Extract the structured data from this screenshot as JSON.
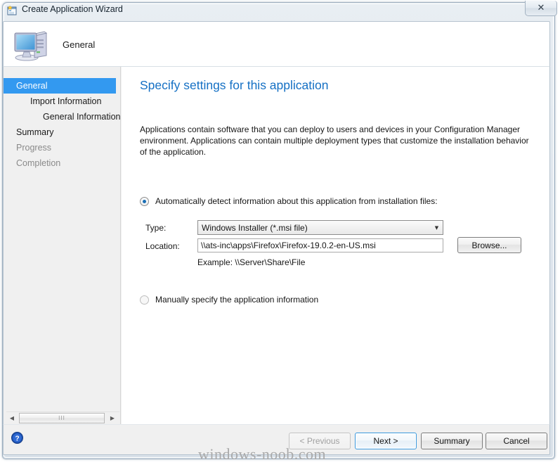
{
  "window": {
    "title": "Create Application Wizard",
    "title_icon": "wizard-window-icon",
    "close_label": "✕"
  },
  "header": {
    "title": "General",
    "icon": "computer-icon"
  },
  "sidebar": {
    "items": [
      {
        "label": "General",
        "indent": 0,
        "state": "selected"
      },
      {
        "label": "Import Information",
        "indent": 1,
        "state": "normal"
      },
      {
        "label": "General Information",
        "indent": 2,
        "state": "normal"
      },
      {
        "label": "Summary",
        "indent": 0,
        "state": "normal"
      },
      {
        "label": "Progress",
        "indent": 0,
        "state": "dim"
      },
      {
        "label": "Completion",
        "indent": 0,
        "state": "dim"
      }
    ],
    "scrollbar": {
      "left_arrow": "◀",
      "right_arrow": "▶",
      "thumb_grip": "III"
    }
  },
  "content": {
    "heading": "Specify settings for this application",
    "description": "Applications contain software that you can deploy to users and devices in your Configuration Manager environment. Applications can contain multiple deployment types that customize the installation behavior of the application.",
    "auto_radio": {
      "label": "Automatically detect information about this application from installation files:",
      "checked": true
    },
    "manual_radio": {
      "label": "Manually specify the application information",
      "checked": false
    },
    "type_label": "Type:",
    "type_value": "Windows Installer (*.msi file)",
    "type_arrow": "▼",
    "location_label": "Location:",
    "location_value": "\\\\ats-inc\\apps\\Firefox\\Firefox-19.0.2-en-US.msi",
    "example_text": "Example: \\\\Server\\Share\\File",
    "browse_label": "Browse..."
  },
  "footer": {
    "help_icon": "help-icon",
    "previous_label": "< Previous",
    "next_label": "Next >",
    "summary_label": "Summary",
    "cancel_label": "Cancel"
  },
  "watermark": "windows-noob.com",
  "colors": {
    "selection_blue": "#3399f0",
    "heading_blue": "#1570c4",
    "default_button_border": "#3c9ade",
    "window_bg": "#f0f0f0"
  }
}
